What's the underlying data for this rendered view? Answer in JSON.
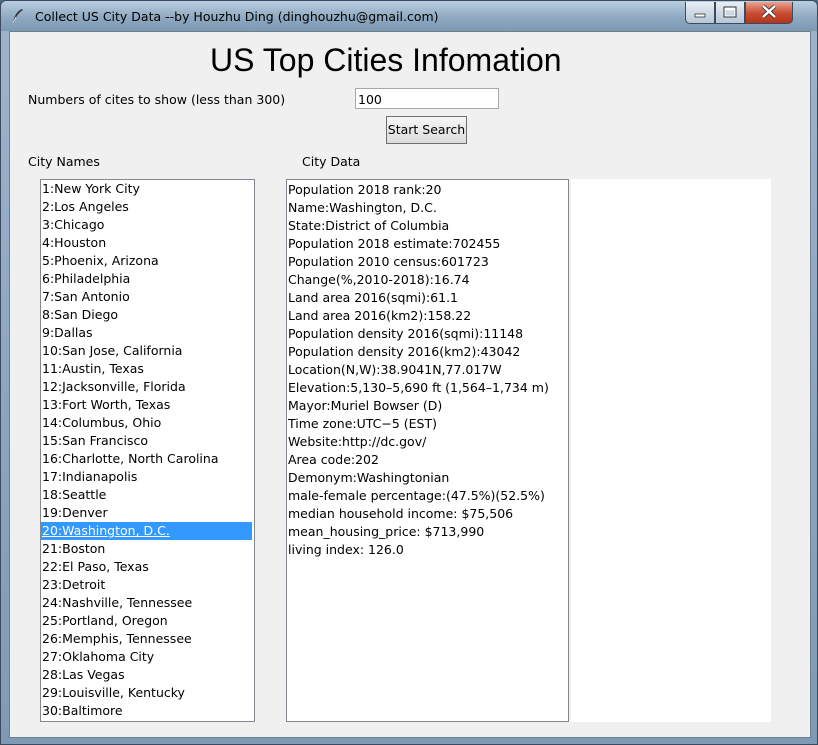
{
  "window": {
    "title": "Collect US City Data --by Houzhu Ding (dinghouzhu@gmail.com)"
  },
  "header": {
    "title": "US Top Cities Infomation"
  },
  "controls": {
    "count_label": "Numbers of cites to show (less than 300)",
    "count_value": "100",
    "search_button": "Start Search"
  },
  "city_names": {
    "label": "City Names",
    "selected_index": 19,
    "items": [
      "1:New York City",
      "2:Los Angeles",
      "3:Chicago",
      "4:Houston",
      "5:Phoenix, Arizona",
      "6:Philadelphia",
      "7:San Antonio",
      "8:San Diego",
      "9:Dallas",
      "10:San Jose, California",
      "11:Austin, Texas",
      "12:Jacksonville, Florida",
      "13:Fort Worth, Texas",
      "14:Columbus, Ohio",
      "15:San Francisco",
      "16:Charlotte, North Carolina",
      "17:Indianapolis",
      "18:Seattle",
      "19:Denver",
      "20:Washington, D.C.",
      "21:Boston",
      "22:El Paso, Texas",
      "23:Detroit",
      "24:Nashville, Tennessee",
      "25:Portland, Oregon",
      "26:Memphis, Tennessee",
      "27:Oklahoma City",
      "28:Las Vegas",
      "29:Louisville, Kentucky",
      "30:Baltimore"
    ]
  },
  "city_data": {
    "label": "City Data",
    "lines": [
      "Population 2018 rank:20",
      "Name:Washington, D.C.",
      "State:District of Columbia",
      "Population 2018 estimate:702455",
      "Population 2010 census:601723",
      "Change(%,2010-2018):16.74",
      "Land area 2016(sqmi):61.1",
      "Land area 2016(km2):158.22",
      "Population density 2016(sqmi):11148",
      "Population density 2016(km2):43042",
      "Location(N,W):38.9041N,77.017W",
      "Elevation:5,130–5,690 ft (1,564–1,734 m)",
      "Mayor:Muriel Bowser (D)",
      "Time zone:UTC−5 (EST)",
      "Website:http://dc.gov/",
      "Area code:202",
      "Demonym:Washingtonian",
      "male-female percentage:(47.5%)(52.5%)",
      "median household income: $75,506",
      "mean_housing_price: $713,990",
      "living index: 126.0"
    ]
  },
  "colors": {
    "selection": "#3399ff",
    "close_button": "#c94a30"
  },
  "icons": {
    "app": "feather-icon",
    "minimize": "minimize-icon",
    "maximize": "maximize-icon",
    "close": "close-icon"
  }
}
